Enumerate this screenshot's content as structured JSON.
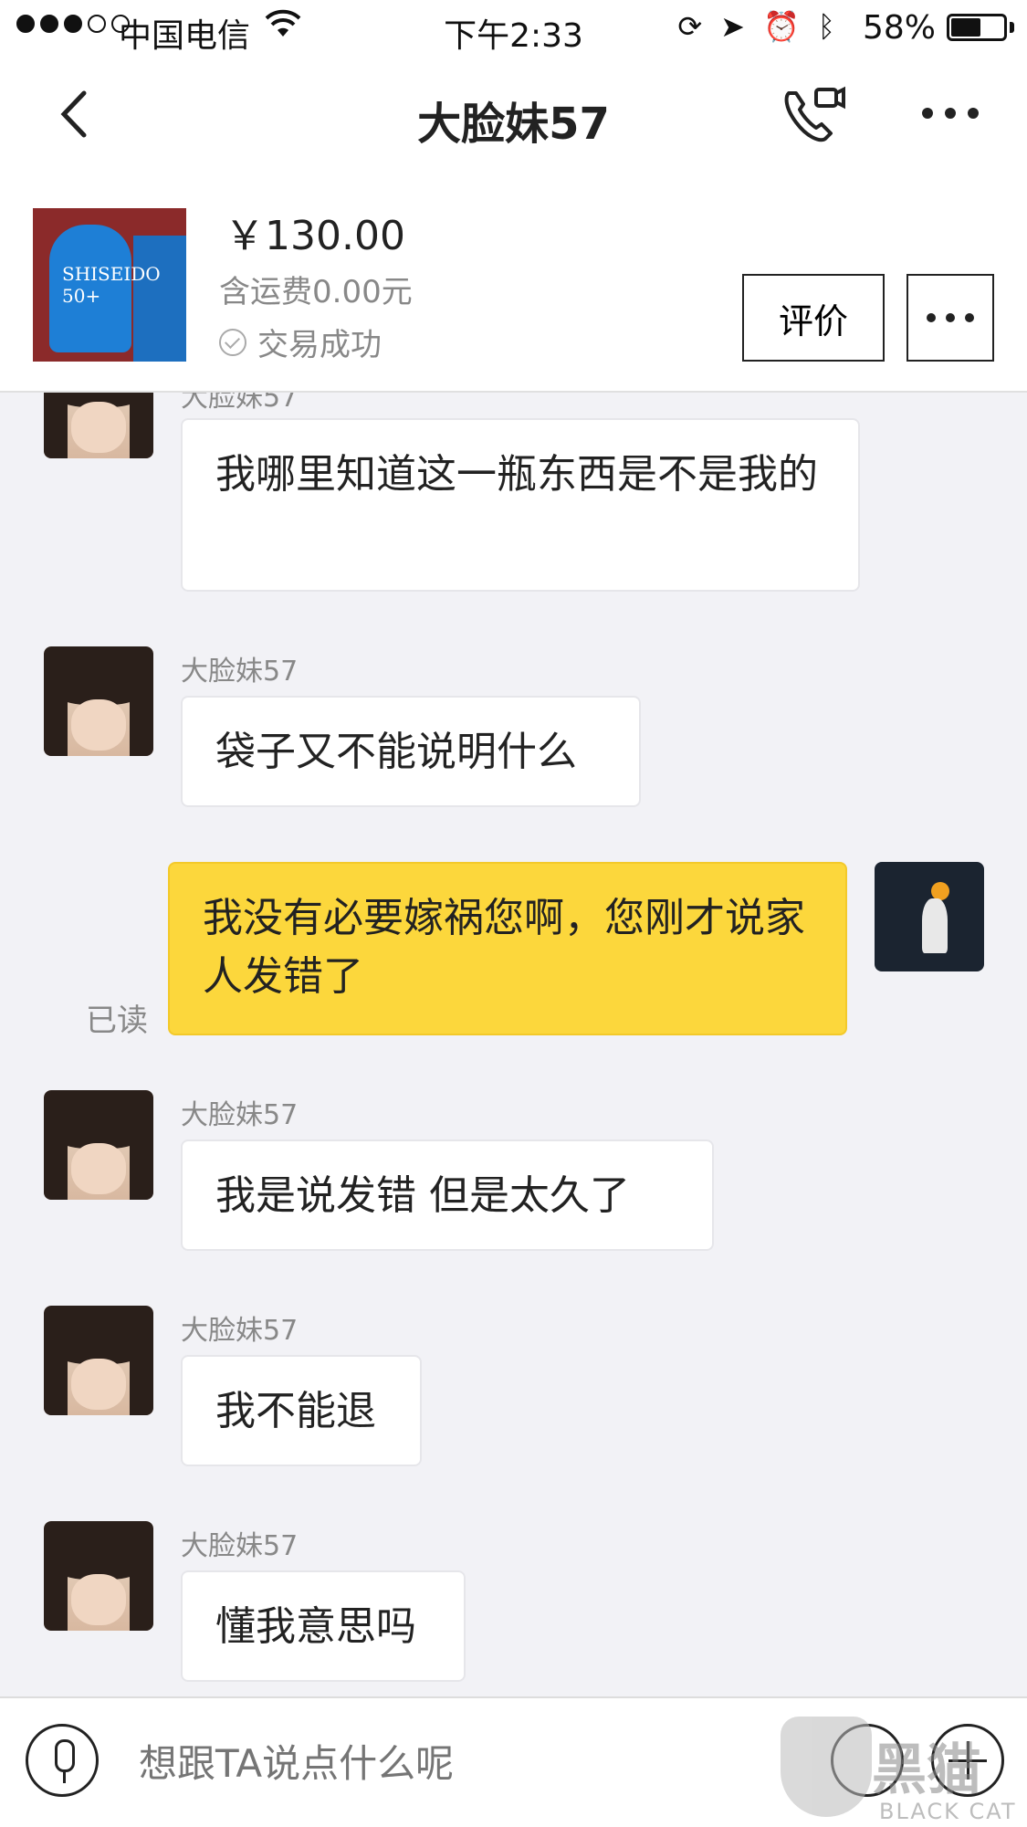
{
  "status_bar": {
    "carrier": "中国电信",
    "time": "下午2:33",
    "battery_percent": "58%",
    "battery_level": 0.58,
    "icons": [
      "lock-rotation-icon",
      "location-icon",
      "alarm-icon",
      "bluetooth-icon"
    ]
  },
  "nav": {
    "title": "大脸妹57",
    "icons": [
      "back-icon",
      "call-video-icon",
      "more-icon"
    ]
  },
  "product": {
    "price": "￥130.00",
    "shipping": "含运费0.00元",
    "status": "交易成功",
    "rate_button": "评价",
    "thumb_label": "SHISEIDO 50+"
  },
  "messages": [
    {
      "side": "left",
      "sender": "大脸妹57",
      "text": "我哪里知道这一瓶东西是不是我的"
    },
    {
      "side": "left",
      "sender": "大脸妹57",
      "text": "袋子又不能说明什么"
    },
    {
      "side": "right",
      "sender": "",
      "text": "我没有必要嫁祸您啊，您刚才说家人发错了",
      "read": "已读"
    },
    {
      "side": "left",
      "sender": "大脸妹57",
      "text": "我是说发错  但是太久了"
    },
    {
      "side": "left",
      "sender": "大脸妹57",
      "text": "我不能退"
    },
    {
      "side": "left",
      "sender": "大脸妹57",
      "text": "懂我意思吗"
    }
  ],
  "input": {
    "placeholder": "想跟TA说点什么呢"
  },
  "watermark": {
    "cn": "黑猫",
    "en": "BLACK CAT"
  },
  "colors": {
    "my_bubble": "#fcd73c",
    "background": "#f2f2f6"
  }
}
